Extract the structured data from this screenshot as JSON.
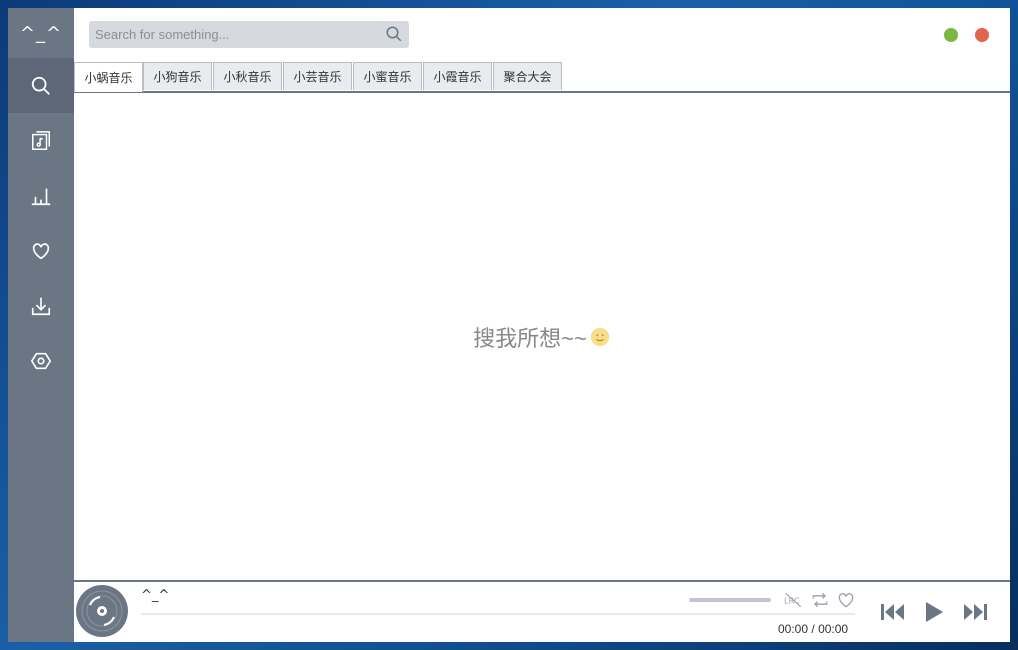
{
  "sidebar": {
    "logo": "^_^",
    "items": [
      {
        "name": "search",
        "icon": "search-icon",
        "active": true
      },
      {
        "name": "playlist",
        "icon": "music-file-icon",
        "active": false
      },
      {
        "name": "charts",
        "icon": "bar-chart-icon",
        "active": false
      },
      {
        "name": "favorites",
        "icon": "heart-icon",
        "active": false
      },
      {
        "name": "downloads",
        "icon": "download-icon",
        "active": false
      },
      {
        "name": "settings",
        "icon": "hexagon-settings-icon",
        "active": false
      }
    ]
  },
  "search": {
    "placeholder": "Search for something..."
  },
  "window_controls": {
    "minimize_color": "#7ab843",
    "close_color": "#e0654e"
  },
  "tabs": [
    {
      "label": "小蜗音乐",
      "active": true
    },
    {
      "label": "小狗音乐",
      "active": false
    },
    {
      "label": "小秋音乐",
      "active": false
    },
    {
      "label": "小芸音乐",
      "active": false
    },
    {
      "label": "小蜜音乐",
      "active": false
    },
    {
      "label": "小霞音乐",
      "active": false
    },
    {
      "label": "聚合大会",
      "active": false
    }
  ],
  "content": {
    "placeholder_text": "搜我所想~~"
  },
  "player": {
    "track_title": "^_^",
    "current_time": "00:00",
    "time_separator": "/",
    "total_time": "00:00",
    "lrc_label": "LRC"
  },
  "colors": {
    "sidebar": "#6b7685",
    "sidebar_active": "#5d6777",
    "accent": "#6b7685"
  }
}
